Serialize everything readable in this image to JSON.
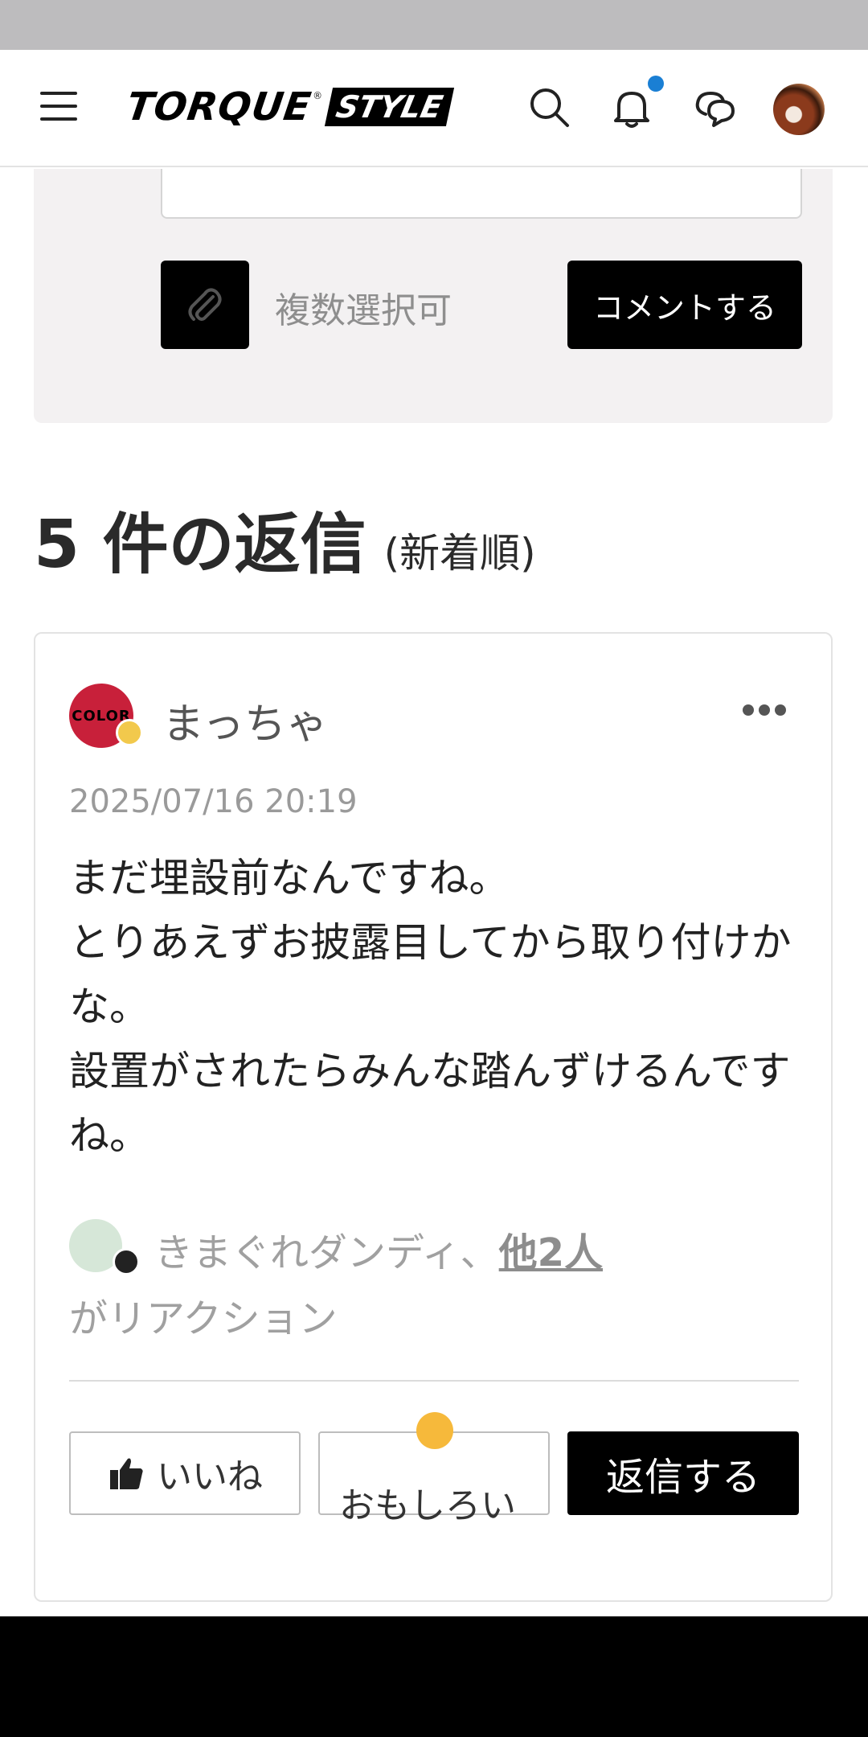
{
  "header": {
    "logo_main": "TORQUE",
    "logo_reg": "®",
    "logo_sub": "STYLE",
    "icons": [
      "menu-icon",
      "search-icon",
      "bell-icon",
      "chat-icon",
      "avatar"
    ],
    "notification_dot_color": "#1a7fd4"
  },
  "composer": {
    "multi_select_label": "複数選択可",
    "comment_button": "コメントする"
  },
  "replies": {
    "count_label": "5 件の返信",
    "sort_label": "(新着順)"
  },
  "comment": {
    "user_name": "まっちゃ",
    "avatar_text": "COLOR",
    "timestamp": "2025/07/16 20:19",
    "body": "まだ埋設前なんですね。\nとりあえずお披露目してから取り付けかな。\n設置がされたらみんな踏んずけるんですね。",
    "reaction_names": "きまぐれダンディ、",
    "reaction_others": "他2人",
    "reaction_suffix": "がリアクション",
    "like_button": "いいね",
    "funny_button": "おもしろい",
    "reply_button": "返信する"
  }
}
